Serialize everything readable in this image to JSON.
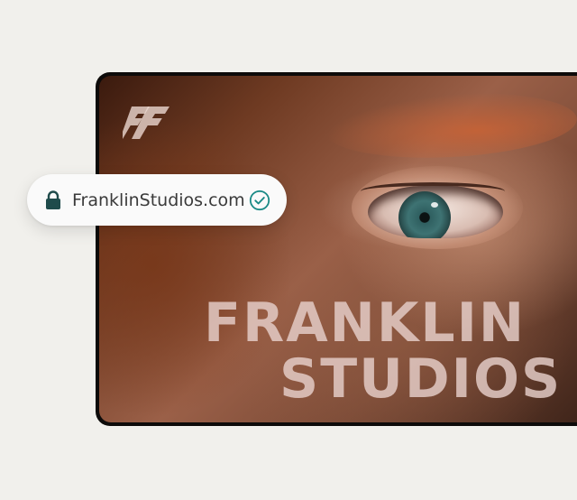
{
  "address_bar": {
    "url": "FranklinStudios.com",
    "secure": true,
    "verified": true,
    "lock_icon": "lock-icon",
    "verified_icon": "check-circle-icon",
    "accent_color": "#1a6b6b"
  },
  "hero": {
    "brand_logo": "franklin-studios-monogram",
    "headline_line1": "FRANKLIN",
    "headline_line2": "STUDIOS"
  },
  "colors": {
    "background": "#f1f0ec",
    "frame": "#0d0b0a",
    "pill": "#fafafa",
    "lock": "#1f4b4b"
  }
}
